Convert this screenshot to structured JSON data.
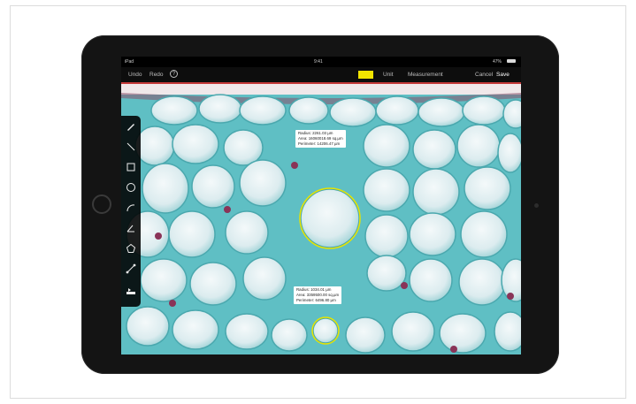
{
  "status": {
    "device": "iPad",
    "time": "9:41",
    "battery": "47%"
  },
  "toolbar": {
    "undo": "Undo",
    "redo": "Redo",
    "help_icon": "question-circle-icon",
    "color": "#f2e400",
    "unit": "Unit",
    "measurement": "Measurement",
    "cancel": "Cancel",
    "save": "Save"
  },
  "tools": [
    {
      "name": "pen-tool-icon"
    },
    {
      "name": "line-tool-icon"
    },
    {
      "name": "rectangle-tool-icon"
    },
    {
      "name": "circle-tool-icon"
    },
    {
      "name": "arc-tool-icon"
    },
    {
      "name": "angle-tool-icon"
    },
    {
      "name": "polygon-tool-icon"
    },
    {
      "name": "point-tool-icon"
    },
    {
      "name": "scale-tool-icon"
    }
  ],
  "measurements": [
    {
      "radius": "Radius: 2261.03 µm",
      "area": "Area: 16060018.69 sq.µm",
      "perimeter": "Perimeter: 14206.47 µm"
    },
    {
      "radius": "Radius: 1034.01 µm",
      "area": "Area: 3359500.00 sq.µm",
      "perimeter": "Perimeter: 6496.80 µm"
    }
  ],
  "colors": {
    "cell": "#e4eef0",
    "tissue": "#55b9bf",
    "annotation": "#e8e400",
    "accent": "#c43a3a"
  }
}
